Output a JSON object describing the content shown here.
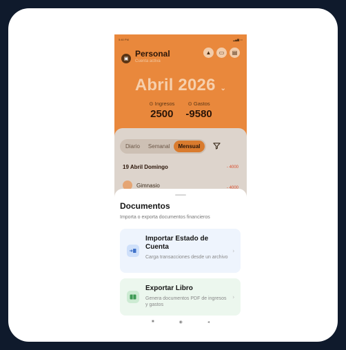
{
  "status_bar": {
    "time": "5:40 PM",
    "right": "▂▄▆ ▭"
  },
  "header": {
    "account_icon": "wallet-icon",
    "title": "Personal",
    "subtitle": "Cuenta activa",
    "buttons": [
      {
        "icon": "upload-icon",
        "glyph": "▲"
      },
      {
        "icon": "card-icon",
        "glyph": "▭"
      },
      {
        "icon": "document-icon",
        "glyph": "▤"
      }
    ],
    "month": "Abril 2026",
    "month_chevron": "⌄",
    "income_label": "Ingresos",
    "income_value": "2500",
    "expense_label": "Gastos",
    "expense_value": "-9580",
    "label_icon": "⊙"
  },
  "period_tabs": {
    "items": [
      "Diario",
      "Semanal",
      "Mensual"
    ],
    "active": "Mensual",
    "filter_icon": "filter-icon"
  },
  "transactions": {
    "day_label": "19 Abril Domingo",
    "day_total": "- 4000",
    "first_item": "Gimnasio",
    "first_amount": "- 4000"
  },
  "sheet": {
    "title": "Documentos",
    "subtitle": "Importa o exporta documentos financieros",
    "options": [
      {
        "title": "Importar Estado de Cuenta",
        "description": "Carga transacciones desde un archivo",
        "icon": "import-icon"
      },
      {
        "title": "Exportar Libro",
        "description": "Genera documentos PDF de ingresos y gastos",
        "icon": "export-book-icon"
      }
    ]
  },
  "nav_bar": {
    "items": [
      "■",
      "◉",
      "◂"
    ]
  },
  "colors": {
    "brand_orange": "#e9883c",
    "active_tab": "#d97b2e",
    "import_bg": "#eef4fd",
    "export_bg": "#ecf7ee",
    "negative": "#d94a2a"
  }
}
